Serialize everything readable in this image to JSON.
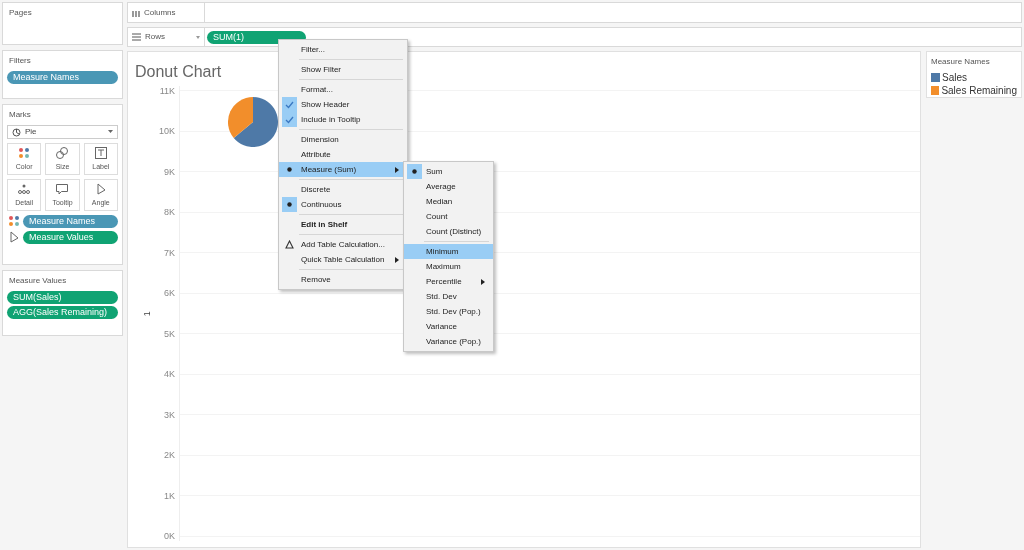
{
  "sidebar": {
    "pages": {
      "title": "Pages"
    },
    "filters": {
      "title": "Filters",
      "pills": [
        {
          "label": "Measure Names",
          "continuous": false
        }
      ]
    },
    "marks": {
      "title": "Marks",
      "mark_type": "Pie",
      "buttons": [
        {
          "kind": "color",
          "label": "Color"
        },
        {
          "kind": "size",
          "label": "Size"
        },
        {
          "kind": "label",
          "label": "Label"
        },
        {
          "kind": "detail",
          "label": "Detail"
        },
        {
          "kind": "tooltip",
          "label": "Tooltip"
        },
        {
          "kind": "angle",
          "label": "Angle"
        }
      ],
      "pills": [
        {
          "kind": "color",
          "label": "Measure Names",
          "continuous": false
        },
        {
          "kind": "angle",
          "label": "Measure Values",
          "continuous": true
        }
      ]
    },
    "measure_values": {
      "title": "Measure Values",
      "pills": [
        {
          "label": "SUM(Sales)",
          "continuous": true
        },
        {
          "label": "AGG(Sales Remaining)",
          "continuous": true
        }
      ]
    }
  },
  "shelves": {
    "columns": {
      "label": "Columns"
    },
    "rows": {
      "label": "Rows",
      "pills": [
        {
          "label": "SUM(1)",
          "continuous": true
        }
      ]
    }
  },
  "chart": {
    "title": "Donut Chart",
    "y_axis_title": "1",
    "yticks": [
      "11K",
      "10K",
      "9K",
      "8K",
      "7K",
      "6K",
      "5K",
      "4K",
      "3K",
      "2K",
      "1K",
      "0K"
    ]
  },
  "legend": {
    "title": "Measure Names",
    "items": [
      {
        "label": "Sales",
        "color": "#4e79a7"
      },
      {
        "label": "Sales Remaining",
        "color": "#f28e2b"
      }
    ]
  },
  "context_menu": {
    "items": [
      {
        "kind": "item",
        "label": "Filter...",
        "checked": false,
        "highlighted": false,
        "submenu": false,
        "bold": false
      },
      {
        "kind": "separator"
      },
      {
        "kind": "item",
        "label": "Show Filter",
        "checked": false,
        "highlighted": false,
        "submenu": false,
        "bold": false
      },
      {
        "kind": "separator"
      },
      {
        "kind": "item",
        "label": "Format...",
        "checked": false,
        "highlighted": false,
        "submenu": false,
        "bold": false
      },
      {
        "kind": "check",
        "label": "Show Header",
        "checked": true,
        "highlighted": false,
        "submenu": false,
        "bold": false
      },
      {
        "kind": "check",
        "label": "Include in Tooltip",
        "checked": true,
        "highlighted": false,
        "submenu": false,
        "bold": false
      },
      {
        "kind": "separator"
      },
      {
        "kind": "item",
        "label": "Dimension",
        "checked": false,
        "highlighted": false,
        "submenu": false,
        "bold": false
      },
      {
        "kind": "item",
        "label": "Attribute",
        "checked": false,
        "highlighted": false,
        "submenu": false,
        "bold": false
      },
      {
        "kind": "item",
        "label": "Measure (Sum)",
        "checked": true,
        "highlighted": true,
        "submenu": true,
        "bold": false
      },
      {
        "kind": "separator"
      },
      {
        "kind": "item",
        "label": "Discrete",
        "checked": false,
        "highlighted": false,
        "submenu": false,
        "bold": false
      },
      {
        "kind": "item",
        "label": "Continuous",
        "checked": true,
        "highlighted": false,
        "submenu": false,
        "bold": false
      },
      {
        "kind": "separator"
      },
      {
        "kind": "item",
        "label": "Edit in Shelf",
        "checked": false,
        "highlighted": false,
        "submenu": false,
        "bold": true
      },
      {
        "kind": "separator"
      },
      {
        "kind": "calc",
        "label": "Add Table Calculation...",
        "checked": false,
        "highlighted": false,
        "submenu": false,
        "bold": false
      },
      {
        "kind": "item",
        "label": "Quick Table Calculation",
        "checked": false,
        "highlighted": false,
        "submenu": true,
        "bold": false
      },
      {
        "kind": "separator"
      },
      {
        "kind": "item",
        "label": "Remove",
        "checked": false,
        "highlighted": false,
        "submenu": false,
        "bold": false
      }
    ]
  },
  "submenu": {
    "items": [
      {
        "kind": "item",
        "label": "Sum",
        "checked": true,
        "highlighted": false,
        "submenu": false,
        "bold": false
      },
      {
        "kind": "item",
        "label": "Average",
        "checked": false,
        "highlighted": false,
        "submenu": false,
        "bold": false
      },
      {
        "kind": "item",
        "label": "Median",
        "checked": false,
        "highlighted": false,
        "submenu": false,
        "bold": false
      },
      {
        "kind": "item",
        "label": "Count",
        "checked": false,
        "highlighted": false,
        "submenu": false,
        "bold": false
      },
      {
        "kind": "item",
        "label": "Count (Distinct)",
        "checked": false,
        "highlighted": false,
        "submenu": false,
        "bold": false
      },
      {
        "kind": "separator"
      },
      {
        "kind": "item",
        "label": "Minimum",
        "checked": false,
        "highlighted": true,
        "submenu": false,
        "bold": false
      },
      {
        "kind": "item",
        "label": "Maximum",
        "checked": false,
        "highlighted": false,
        "submenu": false,
        "bold": false
      },
      {
        "kind": "item",
        "label": "Percentile",
        "checked": false,
        "highlighted": false,
        "submenu": true,
        "bold": false
      },
      {
        "kind": "item",
        "label": "Std. Dev",
        "checked": false,
        "highlighted": false,
        "submenu": false,
        "bold": false
      },
      {
        "kind": "item",
        "label": "Std. Dev (Pop.)",
        "checked": false,
        "highlighted": false,
        "submenu": false,
        "bold": false
      },
      {
        "kind": "item",
        "label": "Variance",
        "checked": false,
        "highlighted": false,
        "submenu": false,
        "bold": false
      },
      {
        "kind": "item",
        "label": "Variance (Pop.)",
        "checked": false,
        "highlighted": false,
        "submenu": false,
        "bold": false
      }
    ]
  }
}
